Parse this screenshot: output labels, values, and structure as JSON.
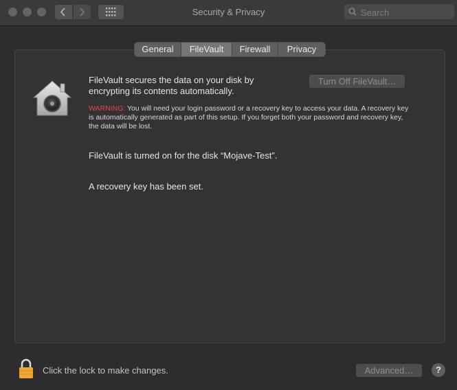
{
  "window": {
    "title": "Security & Privacy"
  },
  "toolbar": {
    "back_icon": "chevron-left-icon",
    "forward_icon": "chevron-right-icon",
    "show_all_icon": "grid-icon",
    "search_placeholder": "Search"
  },
  "tabs": [
    {
      "label": "General",
      "selected": false
    },
    {
      "label": "FileVault",
      "selected": true
    },
    {
      "label": "Firewall",
      "selected": false
    },
    {
      "label": "Privacy",
      "selected": false
    }
  ],
  "filevault": {
    "icon": "filevault-house-icon",
    "headline": "FileVault secures the data on your disk by encrypting its contents automatically.",
    "turn_off_label": "Turn Off FileVault…",
    "warning_label": "WARNING:",
    "warning_text": " You will need your login password or a recovery key to access your data. A recovery key is automatically generated as part of this setup. If you forget both your password and recovery key, the data will be lost.",
    "disk_status": "FileVault is turned on for the disk “Mojave-Test”.",
    "recovery_status": "A recovery key has been set."
  },
  "footer": {
    "lock_icon": "lock-icon",
    "lock_text": "Click the lock to make changes.",
    "advanced_label": "Advanced…",
    "help_label": "?"
  },
  "colors": {
    "warning": "#e8453c",
    "lock": "#f0a830",
    "background": "#2d2d2f",
    "panel": "#333335"
  }
}
